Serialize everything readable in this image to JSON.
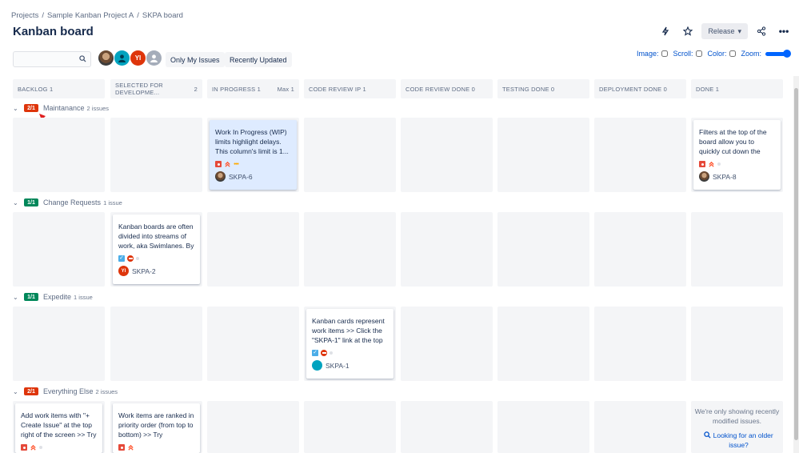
{
  "breadcrumbs": [
    "Projects",
    "Sample Kanban Project A",
    "SKPA board"
  ],
  "title": "Kanban board",
  "header": {
    "release_label": "Release"
  },
  "toolbar": {
    "search_placeholder": "",
    "avatar_yi": "YI",
    "only_my_issues": "Only My Issues",
    "recently_updated": "Recently Updated",
    "image_label": "Image:",
    "scroll_label": "Scroll:",
    "color_label": "Color:",
    "zoom_label": "Zoom:"
  },
  "columns": [
    {
      "name": "BACKLOG 1"
    },
    {
      "name": "SELECTED FOR DEVELOPME...",
      "count": "2"
    },
    {
      "name": "IN PROGRESS 1",
      "max": "Max 1"
    },
    {
      "name": "CODE REVIEW IP 1"
    },
    {
      "name": "CODE REVIEW DONE 0"
    },
    {
      "name": "TESTING DONE 0"
    },
    {
      "name": "DEPLOYMENT DONE 0"
    },
    {
      "name": "DONE 1"
    }
  ],
  "swimlanes": [
    {
      "badge": "2/1",
      "badge_color": "#de350b",
      "name": "Maintanance",
      "count": "2 issues"
    },
    {
      "badge": "1/1",
      "badge_color": "#00875a",
      "name": "Change Requests",
      "count": "1 issue"
    },
    {
      "badge": "1/1",
      "badge_color": "#00875a",
      "name": "Expedite",
      "count": "1 issue"
    },
    {
      "badge": "2/1",
      "badge_color": "#de350b",
      "name": "Everything Else",
      "count": "2 issues"
    }
  ],
  "cards": {
    "skpa6": {
      "summary": "Work In Progress (WIP) limits highlight delays. This column's limit is 1...",
      "key": "SKPA-6"
    },
    "skpa8": {
      "summary": "Filters at the top of the board allow you to quickly cut down the",
      "key": "SKPA-8"
    },
    "skpa2": {
      "summary": "Kanban boards are often divided into streams of work, aka Swimlanes. By",
      "key": "SKPA-2",
      "avatar": "YI"
    },
    "skpa1": {
      "summary": "Kanban cards represent work items >> Click the \"SKPA-1\" link at the top",
      "key": "SKPA-1"
    },
    "else1": {
      "summary": "Add work items with \"+ Create Issue\" at the top right of the screen >> Try"
    },
    "else2": {
      "summary": "Work items are ranked in priority order (from top to bottom) >> Try"
    }
  },
  "older": {
    "message": "We're only showing recently modified issues.",
    "link": "Looking for an older issue?"
  },
  "colors": {
    "accent": "#0052cc",
    "wip_card": "#deebff",
    "red_badge": "#de350b",
    "green_badge": "#00875a"
  }
}
